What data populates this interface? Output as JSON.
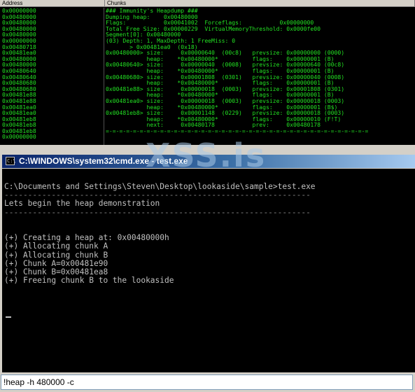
{
  "debugger": {
    "columns": {
      "address": "Address",
      "chunks": "Chunks"
    },
    "addresses": [
      "0x00000000",
      "0x00480000",
      "0x00480000",
      "0x00480000",
      "0x00480000",
      "0x00000000",
      "0x00480718",
      "0x00481ea0",
      "0x00480000",
      "0x00480000",
      "0x00480640",
      "0x00480640",
      "0x00480680",
      "0x00480680",
      "0x00481e88",
      "0x00481e88",
      "0x00481ea0",
      "0x00481ea0",
      "0x00481eb8",
      "0x00481eb8",
      "0x00481eb8",
      "0x00000000"
    ],
    "chunk_lines": [
      "### Immunity's Heapdump ###",
      "Dumping heap:    0x00480000",
      "Flags:           0x00041002  Forceflags:           0x00000000",
      "Total Free Size: 0x00000229  VirtualMemoryThreshold: 0x0000fe00",
      "Segment[0]: 0x00480000",
      "(03) Depth: 1, MaxDepth: 1 FreeMiss: 0",
      "       > 0x00481ea0  (0x18)",
      "0x00480000> size:     0x00000640  (00c8)   prevsize: 0x00000000 (0000)",
      "            heap:    *0x00480000*          flags:    0x00000001 (B)",
      "0x00480640> size:     0x00000040  (0008)   prevsize: 0x00000640 (00c8)",
      "            heap:    *0x00480000*          flags:    0x00000001 (B)",
      "0x00480680> size:     0x00001808  (0301)   prevsize: 0x00000040 (0008)",
      "            heap:    *0x00480000*          flags:    0x00000001 (B)",
      "0x00481e88> size:     0x00000018  (0003)   prevsize: 0x00001808 (0301)",
      "            heap:    *0x00480000*          flags:    0x00000001 (B)",
      "0x00481ea0> size:     0x00000018  (0003)   prevsize: 0x00000018 (0003)",
      "            heap:    *0x00480000*          flags:    0x00000001 (B$)",
      "0x00481eb8> size:     0x00001148  (0229)   prevsize: 0x00000018 (0003)",
      "            heap:    *0x00480000*          flags:    0x00000010 (F!T)",
      "            next:     0x00480178           prev:     0x00480178",
      "=-=-=-=-=-=-=-=-=-=-=-=-=-=-=-=-=-=-=-=-=-=-=-=-=-=-=-=-=-=-=-=-=-=-=-=-=-=-="
    ]
  },
  "watermark": "XSS.is",
  "cmd_window": {
    "title": "C:\\WINDOWS\\system32\\cmd.exe - test.exe",
    "icon_label": "C:\\",
    "lines": [
      {
        "text": "C:\\Documents and Settings\\Steven\\Desktop\\lookaside\\sample>test.exe",
        "kind": "out"
      },
      {
        "text": "-----------------------------------------------------------------",
        "kind": "sep"
      },
      {
        "text": "Lets begin the heap demonstration",
        "kind": "out"
      },
      {
        "text": "-----------------------------------------------------------------",
        "kind": "sep"
      },
      {
        "text": "",
        "kind": "out"
      },
      {
        "text": "",
        "kind": "out"
      },
      {
        "text": "(+) Creating a heap at: 0x00480000h",
        "kind": "out"
      },
      {
        "text": "(+) Allocating chunk A",
        "kind": "out"
      },
      {
        "text": "(+) Allocating chunk B",
        "kind": "out"
      },
      {
        "text": "(+) Chunk A=0x00481e90",
        "kind": "out"
      },
      {
        "text": "(+) Chunk B=0x00481ea8",
        "kind": "out"
      },
      {
        "text": "(+) Freeing chunk B to the lookaside",
        "kind": "out"
      }
    ]
  },
  "command_bar": {
    "value": "!heap -h 480000 -c"
  }
}
